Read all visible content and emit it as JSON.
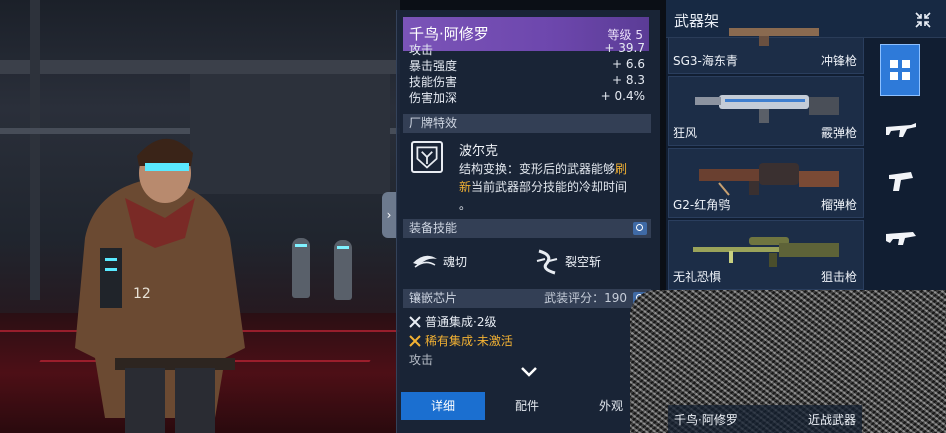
{
  "weapon": {
    "name": "千鸟·阿修罗",
    "level": "等级 5",
    "stats": [
      {
        "label": "攻击",
        "value": "+ 39.7"
      },
      {
        "label": "暴击强度",
        "value": "+ 6.6"
      },
      {
        "label": "技能伤害",
        "value": "+ 8.3"
      },
      {
        "label": "伤害加深",
        "value": "+ 0.4%"
      }
    ]
  },
  "brand": {
    "section_label": "厂牌特效",
    "name": "波尔克",
    "desc_before": "结构变换：变形后的武器能够",
    "desc_highlight1": "刷",
    "desc_highlight2": "新",
    "desc_after": "当前武器部分技能的冷却时间",
    "desc_tail": "。"
  },
  "skills": {
    "section_label": "装备技能",
    "items": [
      {
        "label": "魂切",
        "icon": "slash-swirl-icon"
      },
      {
        "label": "裂空斩",
        "icon": "rift-slash-icon"
      }
    ]
  },
  "chips": {
    "section_label": "镶嵌芯片",
    "score_label": "武装评分：190",
    "items": [
      {
        "label": "普通集成·2级",
        "color": "#e8edf4"
      },
      {
        "label": "稀有集成·未激活",
        "color": "#f2b133"
      },
      {
        "label": "攻击"
      }
    ]
  },
  "tabs": [
    {
      "label": "详细",
      "active": true
    },
    {
      "label": "配件",
      "active": false
    },
    {
      "label": "外观",
      "active": false
    }
  ],
  "rack": {
    "title": "武器架",
    "weapons": [
      {
        "name": "SG3-海东青",
        "type": "冲锋枪"
      },
      {
        "name": "狂风",
        "type": "霰弹枪"
      },
      {
        "name": "G2-红角鸮",
        "type": "榴弹枪"
      },
      {
        "name": "无礼恐惧",
        "type": "狙击枪"
      },
      {
        "name": "千鸟·阿修罗",
        "type": "近战武器"
      }
    ],
    "categories": [
      "all-icon",
      "rifle-icon",
      "pistol-icon",
      "smg-icon",
      "shotgun-icon",
      "launcher-icon",
      "sniper-icon"
    ]
  },
  "colors": {
    "accent_blue": "#2e7ad9",
    "header_purple": "#7b54b8",
    "highlight_orange": "#f2b133"
  }
}
